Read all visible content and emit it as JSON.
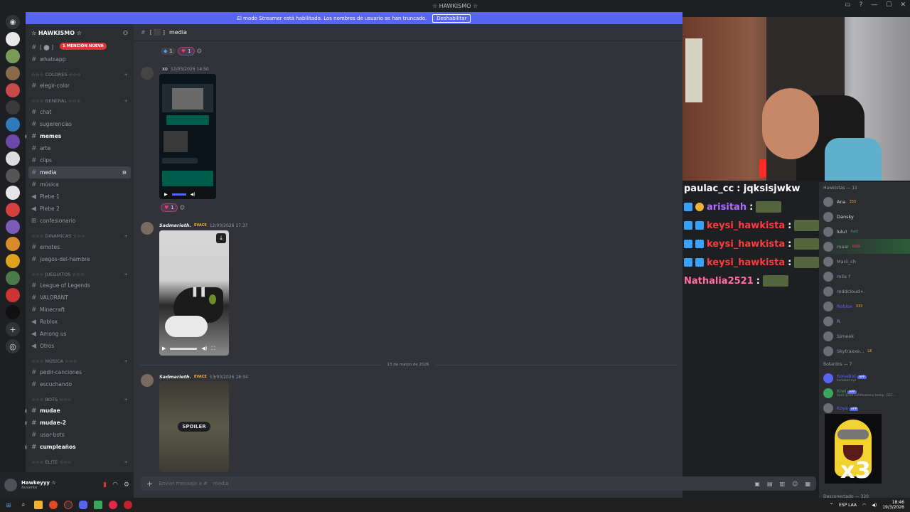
{
  "window": {
    "title": "☆ HAWKISMO ☆"
  },
  "banner": {
    "text": "El modo Streamer está habilitado. Los nombres de usuario se han truncado.",
    "button": "Deshabilitar"
  },
  "guild": {
    "name": "☆ HAWKISMO ☆"
  },
  "sidebar": {
    "mention_pill": "1 MENCIÓN NUEVA",
    "top_channels": [
      {
        "label": "[ ⬤ ]"
      },
      {
        "label": "whatsapp"
      }
    ],
    "categories": [
      {
        "title": "☆☆☆ COLORES ☆☆☆",
        "channels": [
          "elegir-color"
        ]
      },
      {
        "title": "☆☆☆ GENERAL ☆☆☆",
        "channels": [
          "chat",
          "sugerencias",
          "memes",
          "arte",
          "clips",
          "media",
          "música",
          "Plebe 1",
          "Plebe 2",
          "confesionario"
        ]
      },
      {
        "title": "☆☆☆ DINAMICAS ☆☆☆",
        "channels": [
          "emotes",
          "juegos-del-hambre"
        ]
      },
      {
        "title": "☆☆☆ JUEGUITOS ☆☆☆",
        "channels": [
          "League of Legends",
          "VALORANT",
          "Minecraft",
          "Roblox",
          "Among us",
          "Otros"
        ]
      },
      {
        "title": "☆☆☆ MÚSICA ☆☆☆",
        "channels": [
          "pedir-canciones",
          "escuchando"
        ]
      },
      {
        "title": "☆☆☆ BOTS ☆☆☆",
        "channels": [
          "mudae",
          "mudae-2",
          "usar-bots",
          "cumpleaños"
        ]
      },
      {
        "title": "☆☆☆ ÉLITE ☆☆☆",
        "channels": []
      }
    ]
  },
  "user": {
    "name": "Hawkeyyy ☆",
    "status": "Ausente"
  },
  "channel": {
    "name": "media",
    "prefix": "[ ⬛ ]"
  },
  "messages": [
    {
      "author": "",
      "tag": "XO",
      "time": "12/03/2026 14:50"
    },
    {
      "author": "Sadmarieth.",
      "tag": "EVACE",
      "time": "12/03/2026 17:37"
    },
    {
      "author": "Sadmarieth.",
      "tag": "EVACE",
      "time": "13/03/2026 18:34",
      "spoiler": "SPOILER"
    }
  ],
  "reactions": {
    "top_a": "1",
    "top_b": "1",
    "mid": "1"
  },
  "date_divider": "13 de marzo de 2026",
  "composer": {
    "placeholder": "Enviar mensaje a #",
    "channel": "media"
  },
  "stream_chat": [
    {
      "user": "paulac_cc",
      "text": ": jqksisjwkw",
      "color": "#ffffff"
    },
    {
      "user": "arisitah",
      "text": ":",
      "color": "#b06bff"
    },
    {
      "user": "keysi_hawkista",
      "text": ":",
      "color": "#ff3b3b"
    },
    {
      "user": "keysi_hawkista",
      "text": ":",
      "color": "#ff3b3b"
    },
    {
      "user": "keysi_hawkista",
      "text": ":",
      "color": "#ff3b3b"
    },
    {
      "user": "Nathalia2521",
      "text": ":",
      "color": "#ff6fa0"
    }
  ],
  "members": {
    "header1": "Hawkistas — 11",
    "list1": [
      {
        "name": "Ana",
        "extra": "333"
      },
      {
        "name": "Dansky",
        "extra": ""
      },
      {
        "name": "lulu!",
        "extra": "Pat0"
      },
      {
        "name": "maar",
        "extra": "KISS"
      },
      {
        "name": "Marii_ch",
        "extra": ""
      },
      {
        "name": "mila ?",
        "extra": ""
      },
      {
        "name": "reddcloud+.",
        "extra": ""
      },
      {
        "name": "Roblox",
        "extra": "333"
      },
      {
        "name": "R.",
        "extra": ""
      },
      {
        "name": "Simeek",
        "extra": ""
      },
      {
        "name": "Skytraxxe...",
        "extra": "LK"
      }
    ],
    "header2": "Botardos — 7",
    "list2": [
      {
        "name": "KonaBot",
        "app": "APP",
        "sub": "konabot.xyz"
      },
      {
        "name": "Kiwi",
        "app": "APP",
        "sub": "Sent 3218 notifications today. (311..."
      },
      {
        "name": "Koya",
        "app": "APP",
        "sub": ""
      }
    ],
    "overlay_text": "x3",
    "header3": "Desconectado — 320"
  },
  "taskbar": {
    "lang": "ESP LAA",
    "time": "18:46",
    "date": "19/3/2026"
  }
}
